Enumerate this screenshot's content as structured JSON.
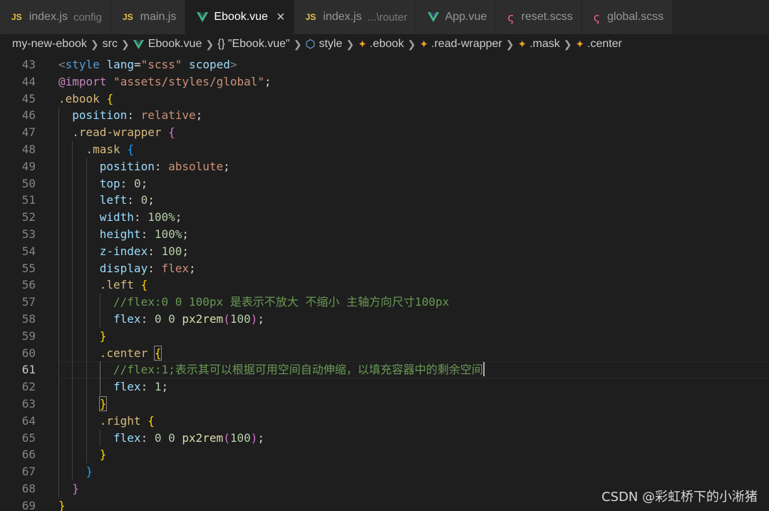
{
  "tabs": [
    {
      "icon": "js-icon",
      "label": "index.js",
      "desc": "config",
      "active": false
    },
    {
      "icon": "js-icon",
      "label": "main.js",
      "desc": "",
      "active": false
    },
    {
      "icon": "vue-icon",
      "label": "Ebook.vue",
      "desc": "",
      "active": true
    },
    {
      "icon": "js-icon",
      "label": "index.js",
      "desc": "...\\router",
      "active": false
    },
    {
      "icon": "vue-icon",
      "label": "App.vue",
      "desc": "",
      "active": false
    },
    {
      "icon": "scss-icon",
      "label": "reset.scss",
      "desc": "",
      "active": false
    },
    {
      "icon": "scss-icon",
      "label": "global.scss",
      "desc": "",
      "active": false
    }
  ],
  "breadcrumb": [
    {
      "icon": "",
      "label": "my-new-ebook"
    },
    {
      "icon": "",
      "label": "src"
    },
    {
      "icon": "vue-icon",
      "label": "Ebook.vue"
    },
    {
      "icon": "braces-icon",
      "label": "\"Ebook.vue\""
    },
    {
      "icon": "cube-icon",
      "label": "style"
    },
    {
      "icon": "selector-icon",
      "label": ".ebook"
    },
    {
      "icon": "selector-icon",
      "label": ".read-wrapper"
    },
    {
      "icon": "selector-icon",
      "label": ".mask"
    },
    {
      "icon": "selector-icon",
      "label": ".center"
    }
  ],
  "editor": {
    "current_line": 61,
    "lines": [
      {
        "n": 43,
        "indent": 0,
        "tokens": [
          [
            "t-punct",
            "<"
          ],
          [
            "t-tag",
            "style"
          ],
          [
            "",
            ""
          ],
          [
            "t-attr",
            " lang"
          ],
          [
            "",
            "="
          ],
          [
            "t-str",
            "\"scss\""
          ],
          [
            "t-attr",
            " scoped"
          ],
          [
            "t-punct",
            ">"
          ]
        ]
      },
      {
        "n": 44,
        "indent": 0,
        "tokens": [
          [
            "t-at",
            "@import"
          ],
          [
            "",
            " "
          ],
          [
            "t-str",
            "\"assets/styles/global\""
          ],
          [
            "",
            ";"
          ]
        ]
      },
      {
        "n": 45,
        "indent": 0,
        "tokens": [
          [
            "t-sel",
            ".ebook"
          ],
          [
            "",
            " "
          ],
          [
            "b1",
            "{"
          ]
        ]
      },
      {
        "n": 46,
        "indent": 1,
        "tokens": [
          [
            "t-prop",
            "position"
          ],
          [
            "",
            ": "
          ],
          [
            "t-val",
            "relative"
          ],
          [
            "",
            ";"
          ]
        ]
      },
      {
        "n": 47,
        "indent": 1,
        "tokens": [
          [
            "t-sel",
            ".read-wrapper"
          ],
          [
            "",
            " "
          ],
          [
            "b2",
            "{"
          ]
        ]
      },
      {
        "n": 48,
        "indent": 2,
        "tokens": [
          [
            "t-sel",
            ".mask"
          ],
          [
            "",
            " "
          ],
          [
            "b3",
            "{"
          ]
        ]
      },
      {
        "n": 49,
        "indent": 3,
        "tokens": [
          [
            "t-prop",
            "position"
          ],
          [
            "",
            ": "
          ],
          [
            "t-val",
            "absolute"
          ],
          [
            "",
            ";"
          ]
        ]
      },
      {
        "n": 50,
        "indent": 3,
        "tokens": [
          [
            "t-prop",
            "top"
          ],
          [
            "",
            ": "
          ],
          [
            "t-num",
            "0"
          ],
          [
            "",
            ";"
          ]
        ]
      },
      {
        "n": 51,
        "indent": 3,
        "tokens": [
          [
            "t-prop",
            "left"
          ],
          [
            "",
            ": "
          ],
          [
            "t-num",
            "0"
          ],
          [
            "",
            ";"
          ]
        ]
      },
      {
        "n": 52,
        "indent": 3,
        "tokens": [
          [
            "t-prop",
            "width"
          ],
          [
            "",
            ": "
          ],
          [
            "t-num",
            "100%"
          ],
          [
            "",
            ";"
          ]
        ]
      },
      {
        "n": 53,
        "indent": 3,
        "tokens": [
          [
            "t-prop",
            "height"
          ],
          [
            "",
            ": "
          ],
          [
            "t-num",
            "100%"
          ],
          [
            "",
            ";"
          ]
        ]
      },
      {
        "n": 54,
        "indent": 3,
        "tokens": [
          [
            "t-prop",
            "z-index"
          ],
          [
            "",
            ": "
          ],
          [
            "t-num",
            "100"
          ],
          [
            "",
            ";"
          ]
        ]
      },
      {
        "n": 55,
        "indent": 3,
        "tokens": [
          [
            "t-prop",
            "display"
          ],
          [
            "",
            ": "
          ],
          [
            "t-val",
            "flex"
          ],
          [
            "",
            ";"
          ]
        ]
      },
      {
        "n": 56,
        "indent": 3,
        "tokens": [
          [
            "t-sel",
            ".left"
          ],
          [
            "",
            " "
          ],
          [
            "b1",
            "{"
          ]
        ]
      },
      {
        "n": 57,
        "indent": 4,
        "tokens": [
          [
            "t-cm",
            "//flex:0 0 100px 是表示不放大 不缩小 主轴方向尺寸100px"
          ]
        ]
      },
      {
        "n": 58,
        "indent": 4,
        "tokens": [
          [
            "t-prop",
            "flex"
          ],
          [
            "",
            ": "
          ],
          [
            "t-num",
            "0"
          ],
          [
            "",
            " "
          ],
          [
            "t-num",
            "0"
          ],
          [
            "",
            " "
          ],
          [
            "t-fn",
            "px2rem"
          ],
          [
            "b2",
            "("
          ],
          [
            "t-num",
            "100"
          ],
          [
            "b2",
            ")"
          ],
          [
            "",
            ";"
          ]
        ]
      },
      {
        "n": 59,
        "indent": 3,
        "tokens": [
          [
            "b1",
            "}"
          ]
        ]
      },
      {
        "n": 60,
        "indent": 3,
        "tokens": [
          [
            "t-sel",
            ".center"
          ],
          [
            "",
            " "
          ],
          [
            "b1 b-match",
            "{"
          ]
        ]
      },
      {
        "n": 61,
        "indent": 4,
        "tokens": [
          [
            "t-cm",
            "//flex:1;表示其可以根据可用空间自动伸缩，以填充容器中的剩余空间"
          ]
        ],
        "caret": true
      },
      {
        "n": 62,
        "indent": 4,
        "tokens": [
          [
            "t-prop",
            "flex"
          ],
          [
            "",
            ": "
          ],
          [
            "t-num",
            "1"
          ],
          [
            "",
            ";"
          ]
        ]
      },
      {
        "n": 63,
        "indent": 3,
        "tokens": [
          [
            "b1 b-match",
            "}"
          ]
        ]
      },
      {
        "n": 64,
        "indent": 3,
        "tokens": [
          [
            "t-sel",
            ".right"
          ],
          [
            "",
            " "
          ],
          [
            "b1",
            "{"
          ]
        ]
      },
      {
        "n": 65,
        "indent": 4,
        "tokens": [
          [
            "t-prop",
            "flex"
          ],
          [
            "",
            ": "
          ],
          [
            "t-num",
            "0"
          ],
          [
            "",
            " "
          ],
          [
            "t-num",
            "0"
          ],
          [
            "",
            " "
          ],
          [
            "t-fn",
            "px2rem"
          ],
          [
            "b2",
            "("
          ],
          [
            "t-num",
            "100"
          ],
          [
            "b2",
            ")"
          ],
          [
            "",
            ";"
          ]
        ]
      },
      {
        "n": 66,
        "indent": 3,
        "tokens": [
          [
            "b1",
            "}"
          ]
        ]
      },
      {
        "n": 67,
        "indent": 2,
        "tokens": [
          [
            "b3",
            "}"
          ]
        ]
      },
      {
        "n": 68,
        "indent": 1,
        "tokens": [
          [
            "b2",
            "}"
          ]
        ]
      },
      {
        "n": 69,
        "indent": 0,
        "tokens": [
          [
            "b1",
            "}"
          ]
        ]
      }
    ]
  },
  "watermark": "CSDN @彩虹桥下的小淅猪"
}
